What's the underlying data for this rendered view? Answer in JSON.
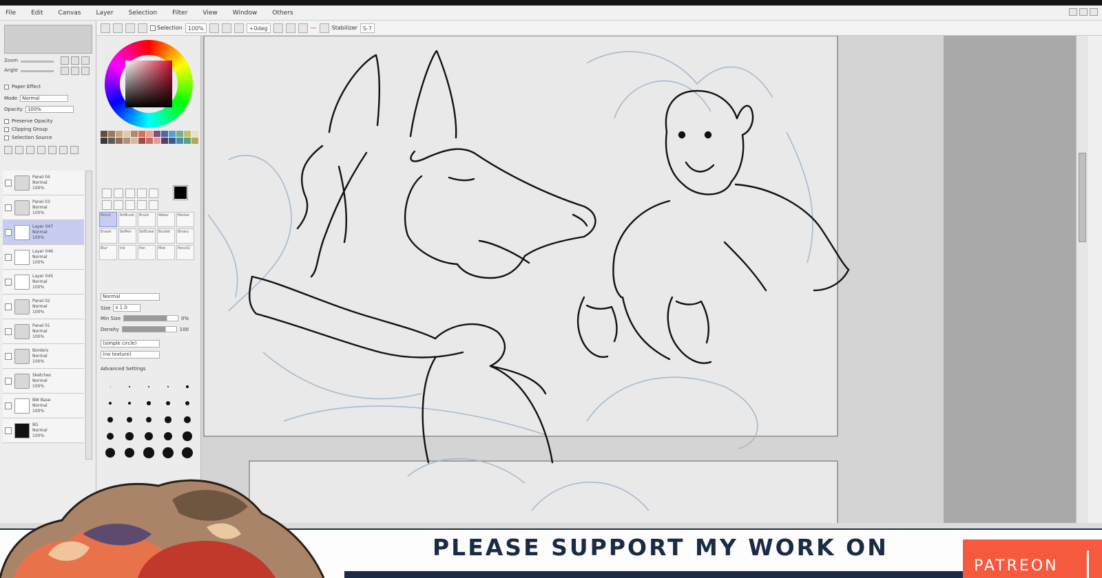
{
  "app": {
    "menus": [
      "File",
      "Edit",
      "Canvas",
      "Layer",
      "Selection",
      "Filter",
      "View",
      "Window",
      "Others"
    ]
  },
  "toolbar": {
    "selection_check": "Selection",
    "zoom_value": "100%",
    "angle_value": "+0deg",
    "stabilizer_label": "Stabilizer",
    "stabilizer_value": "S-7",
    "red_mark": "—"
  },
  "navigator": {
    "zoom_label": "Zoom",
    "zoom_value": "100.0%",
    "angle_label": "Angle",
    "angle_value": "+0deg"
  },
  "layer_panel": {
    "paper_effect": "Paper Effect",
    "mode_label": "Mode",
    "mode_value": "Normal",
    "opacity_label": "Opacity",
    "opacity_value": "100%",
    "options": [
      "Preserve Opacity",
      "Clipping Group",
      "Selection Source"
    ],
    "layers": [
      {
        "name": "Panel 04",
        "mode": "Normal",
        "opacity": "100%",
        "kind": "folder",
        "selected": false
      },
      {
        "name": "Panel 03",
        "mode": "Normal",
        "opacity": "100%",
        "kind": "folder",
        "selected": false
      },
      {
        "name": "Layer 047",
        "mode": "Normal",
        "opacity": "100%",
        "kind": "layer",
        "selected": true
      },
      {
        "name": "Layer 046",
        "mode": "Normal",
        "opacity": "100%",
        "kind": "layer",
        "selected": false
      },
      {
        "name": "Layer 045",
        "mode": "Normal",
        "opacity": "100%",
        "kind": "layer",
        "selected": false
      },
      {
        "name": "Panel 02",
        "mode": "Normal",
        "opacity": "100%",
        "kind": "folder",
        "selected": false
      },
      {
        "name": "Panel 01",
        "mode": "Normal",
        "opacity": "100%",
        "kind": "folder",
        "selected": false
      },
      {
        "name": "Borders",
        "mode": "Normal",
        "opacity": "100%",
        "kind": "folder",
        "selected": false
      },
      {
        "name": "Sketches",
        "mode": "Normal",
        "opacity": "100%",
        "kind": "folder",
        "selected": false
      },
      {
        "name": "BW Base",
        "mode": "Normal",
        "opacity": "100%",
        "kind": "layer",
        "selected": false
      },
      {
        "name": "BG",
        "mode": "Normal",
        "opacity": "100%",
        "kind": "black",
        "selected": false
      }
    ]
  },
  "tools": {
    "brushes": [
      "Pencil",
      "AirBrush",
      "Brush",
      "Water",
      "Marker",
      "Eraser",
      "SelPen",
      "SelErase",
      "Bucket",
      "Binary",
      "Blur",
      "Ink",
      "Pen",
      "Mist",
      "Pencil2"
    ],
    "blend_mode": "Normal",
    "size_label": "Size",
    "size_value": "x 1.0",
    "min_size_label": "Min Size",
    "min_size_value": "0%",
    "density_label": "Density",
    "density_value": "100",
    "shape_value": "(simple circle)",
    "texture_value": "(no texture)",
    "advanced": "Advanced Settings",
    "dot_sizes": [
      "0.7",
      "0.8",
      "1",
      "1.5",
      "2",
      "2.3",
      "2.6",
      "3",
      "3.5",
      "4",
      "5",
      "6",
      "7",
      "8",
      "9",
      "10",
      "12",
      "14",
      "16",
      "20",
      "25",
      "30",
      "35",
      "40",
      "50"
    ]
  },
  "colors": {
    "accent": "#c7cdf0",
    "banner_navy": "#1b2a45",
    "patreon_orange": "#f55a3f",
    "swatches": [
      "#6b4a3a",
      "#9a7a5a",
      "#c9a57e",
      "#e3c9a6",
      "#b8866a",
      "#d76f5a",
      "#f0a08a",
      "#7a4f8a",
      "#4c6aa8",
      "#5aa0c8",
      "#6fb48c",
      "#c4c06a",
      "#e8e0c8",
      "#3a3a3a",
      "#5a5a5a",
      "#8a6a5a",
      "#b0907a",
      "#d8b89a",
      "#a04a4a",
      "#c86a6a",
      "#e89a9a",
      "#5a3a6a",
      "#3a5a8a",
      "#4a8ab0",
      "#5aa07a",
      "#b0a85a"
    ]
  },
  "banner": {
    "text": "PLEASE SUPPORT MY WORK ON",
    "patreon": "PATREON"
  }
}
